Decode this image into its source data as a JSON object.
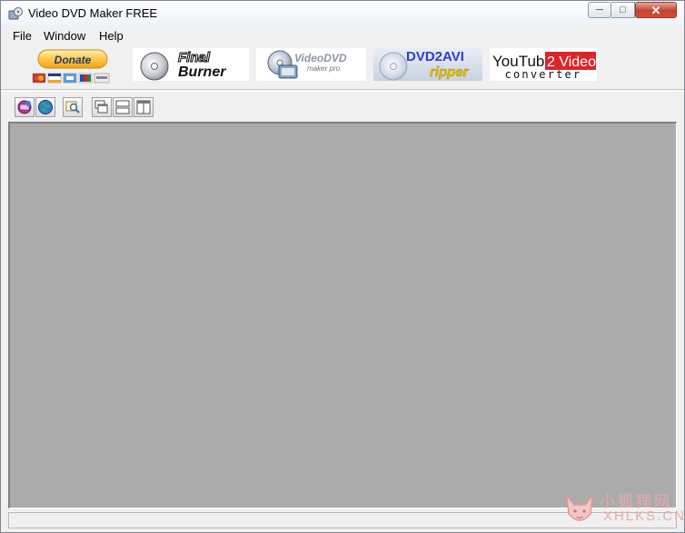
{
  "window": {
    "title": "Video DVD Maker FREE"
  },
  "menu": {
    "items": [
      "File",
      "Window",
      "Help"
    ]
  },
  "ads": {
    "donate": {
      "label": "Donate"
    },
    "final_burner": {
      "line1": "Final",
      "line2": "Burner"
    },
    "videodvd": {
      "line1": "VideoDVD",
      "line2": "maker pro"
    },
    "dvd2avi": {
      "line1": "DVD2AVI",
      "line2": "ripper"
    },
    "youtube2video": {
      "part1": "YouTube",
      "part2": "2 Video",
      "line2": "converter"
    }
  },
  "watermark": {
    "chinese": "小狐狸网",
    "latin": "XHLKS.CN"
  },
  "colors": {
    "workspace": "#ababab",
    "close_button": "#c7412f",
    "youtube_red": "#d9262b",
    "dvd2avi_text": "#2b3ed6",
    "ripper_text": "#e8c200",
    "watermark": "#e9a9a9"
  }
}
